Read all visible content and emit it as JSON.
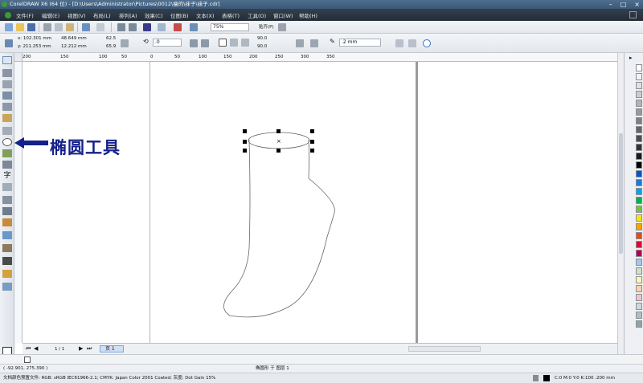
{
  "window": {
    "title": "CorelDRAW X6 (64 位) - [D:\\Users\\Administrator\\Pictures\\0012\\瘦的\\袜子\\袜子.cdr]",
    "minimize": "–",
    "maximize": "□",
    "close": "×"
  },
  "menu": [
    "文件(F)",
    "编辑(E)",
    "视图(V)",
    "布局(L)",
    "排列(A)",
    "效果(C)",
    "位图(B)",
    "文本(X)",
    "表格(T)",
    "工具(O)",
    "窗口(W)",
    "帮助(H)"
  ],
  "standard_toolbar": {
    "zoom": "75%",
    "snap": "贴齐(P)"
  },
  "property_bar": {
    "x": "x: 102.301 mm",
    "y": "y: 211.253 mm",
    "width": "48.649 mm",
    "height": "12.212 mm",
    "scale_x": "62.5",
    "scale_y": "65.9",
    "angle": ".0",
    "start_angle": "90.0",
    "end_angle": "90.0",
    "outline_width": ".2 mm"
  },
  "ruler_ticks": [
    "200",
    "150",
    "100",
    "50",
    "0",
    "50",
    "100",
    "150",
    "200",
    "250",
    "300",
    "350"
  ],
  "annotation": {
    "label": "椭圆工具"
  },
  "page_nav": {
    "count": "1 / 1",
    "tab": "页 1"
  },
  "status": {
    "coords": "( -92.901, 275.390 )",
    "selection": "椭圆形 于 图层 1",
    "color_profile": "文档颜色预置文件: RGB: sRGB IEC61966-2.1; CMYK: Japan Color 2001 Coated; 灰度: Dot Gain 15%",
    "fill_info": "C:0 M:0 Y:0 K:100  .200 mm"
  },
  "palette_colors": [
    "#ffffff",
    "#f2f2f2",
    "#e0e0e0",
    "#cccccc",
    "#b3b3b3",
    "#999999",
    "#808080",
    "#666666",
    "#4d4d4d",
    "#333333",
    "#1a1a1a",
    "#000000",
    "#0055c8",
    "#1f7ad8",
    "#00a6e8",
    "#00b050",
    "#7ac143",
    "#ffe600",
    "#f7a600",
    "#e84d0e",
    "#e4002b",
    "#b3004f",
    "#a6c8e8",
    "#c9e3c5",
    "#fff5b0",
    "#ffd0b0",
    "#f6c0cc",
    "#cfd8dc",
    "#b0bec5",
    "#90a4ae"
  ],
  "accent": "#15208a"
}
